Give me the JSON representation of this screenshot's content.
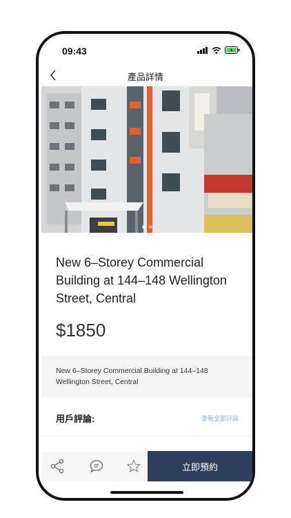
{
  "status_bar": {
    "time": "09:43"
  },
  "nav": {
    "title": "產品詳情"
  },
  "product": {
    "title": "New 6–Storey Commercial Building at 144–148 Wellington Street, Central",
    "price": "$1850",
    "description": "New 6–Storey Commercial Building at 144–148 Wellington Street, Central"
  },
  "reviews": {
    "label": "用戶評論:",
    "view_all": "查看全部評論"
  },
  "bottom_bar": {
    "book_label": "立即預約"
  },
  "carousel": {
    "count": 2,
    "active_index": 1
  },
  "colors": {
    "accent": "#2e3e5c",
    "link": "#8fb4dc",
    "facade_orange": "#e2602e"
  }
}
